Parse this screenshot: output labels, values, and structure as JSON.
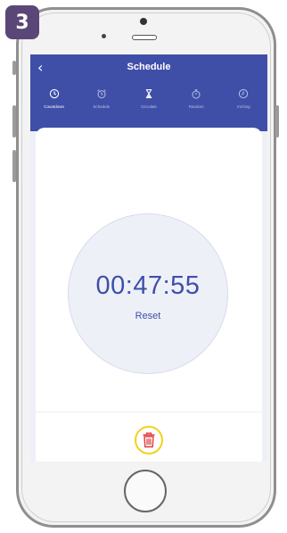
{
  "step_badge": "3",
  "header": {
    "back_glyph": "‹",
    "title": "Schedule"
  },
  "tabs": [
    {
      "label": "Countdown",
      "icon": "clock-icon",
      "active": true
    },
    {
      "label": "Schedule",
      "icon": "alarm-clock-icon",
      "active": false
    },
    {
      "label": "Circulate",
      "icon": "hourglass-icon",
      "active": false
    },
    {
      "label": "Random",
      "icon": "stopwatch-icon",
      "active": false
    },
    {
      "label": "Inching",
      "icon": "clock-icon",
      "active": false
    }
  ],
  "timer": {
    "value": "00:47:55",
    "reset_label": "Reset"
  },
  "delete_button": {
    "icon": "trash-icon"
  },
  "colors": {
    "brand": "#3f4fa8",
    "badge": "#5b4678",
    "highlight": "#f2d21a",
    "delete": "#e03c3c"
  }
}
